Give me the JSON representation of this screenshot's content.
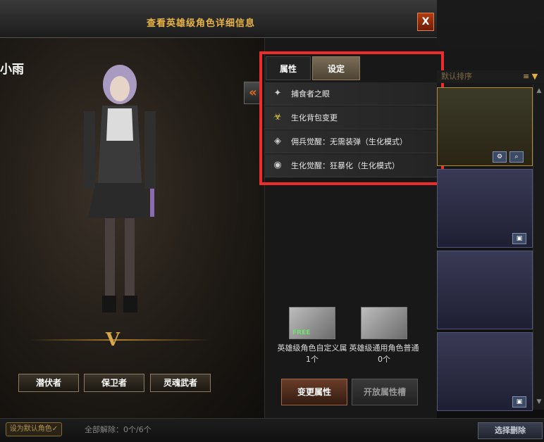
{
  "window": {
    "title": "查看英雄级角色详细信息",
    "close_label": "X"
  },
  "character": {
    "name": "小雨",
    "rank_mark": "V"
  },
  "class_buttons": [
    "潜伏者",
    "保卫者",
    "灵魂武者"
  ],
  "collapse_label": "«",
  "tabs": [
    {
      "label": "属性"
    },
    {
      "label": "设定"
    }
  ],
  "perks": [
    {
      "icon": "eye-claw-icon",
      "label": "捕食者之眼"
    },
    {
      "icon": "biohazard-bag-icon",
      "label": "生化背包变更"
    },
    {
      "icon": "mercenary-icon",
      "label": "佣兵觉醒：无需装弹（生化模式）"
    },
    {
      "icon": "bio-awaken-icon",
      "label": "生化觉醒：狂暴化（生化模式）"
    }
  ],
  "items": [
    {
      "name": "英雄级角色自定义属",
      "count": "1个",
      "tag": "FREE"
    },
    {
      "name": "英雄级通用角色普通",
      "count": "0个"
    }
  ],
  "actions": {
    "change": "变更属性",
    "open_slot": "开放属性槽"
  },
  "list": {
    "sort_label": "默认排序"
  },
  "bottom": {
    "set_default": "设为默认角色✓",
    "unlocked_label": "全部解除：",
    "unlocked_value": "0个/6个",
    "select_delete": "选择删除"
  },
  "colors": {
    "accent": "#e7b347",
    "highlight": "#ef2c2c"
  }
}
